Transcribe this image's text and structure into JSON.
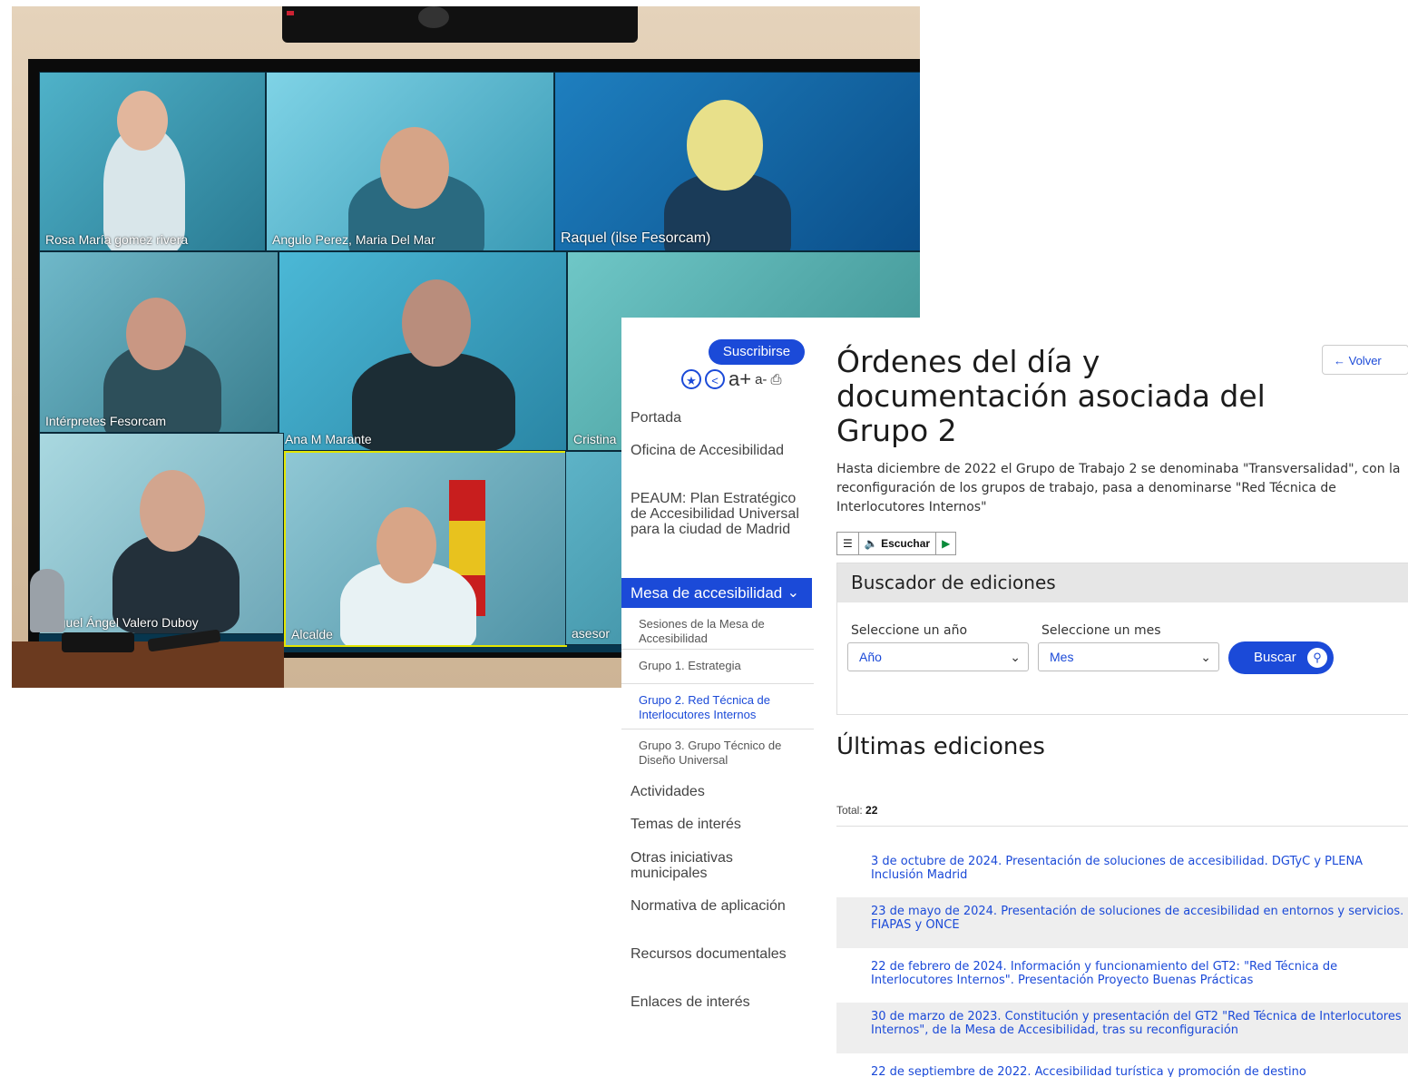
{
  "video_call": {
    "participants": [
      {
        "name": "Rosa María gomez rivera"
      },
      {
        "name": "Angulo Perez, Maria Del Mar"
      },
      {
        "name": "Raquel (ilse Fesorcam)"
      },
      {
        "name": "Intérpretes Fesorcam"
      },
      {
        "name": "Ana M Marante"
      },
      {
        "name": "Cristina"
      },
      {
        "name": "Miguel Ángel Valero Duboy"
      },
      {
        "name": "Alcalde"
      },
      {
        "name": "asesor"
      }
    ]
  },
  "web": {
    "subscribe_label": "Suscribirse",
    "tools": {
      "font_up": "a+",
      "font_down": "a-"
    },
    "nav": {
      "portada": "Portada",
      "oficina": "Oficina de Accesibilidad",
      "peaum": "PEAUM: Plan Estratégico de Accesibilidad Universal para la ciudad de Madrid",
      "mesa": "Mesa de accesibilidad",
      "sub": [
        "Sesiones de la Mesa de Accesibilidad",
        "Grupo 1. Estrategia",
        "Grupo 2. Red Técnica de Interlocutores Internos",
        "Grupo 3. Grupo Técnico de Diseño Universal"
      ],
      "actividades": "Actividades",
      "temas": "Temas de interés",
      "otras": "Otras iniciativas municipales",
      "normativa": "Normativa de aplicación",
      "recursos": "Recursos documentales",
      "enlaces": "Enlaces de interés"
    },
    "back_label": "Volver",
    "title": "Órdenes del día y documentación asociada del Grupo 2",
    "intro": "Hasta diciembre de 2022 el Grupo de Trabajo 2 se denominaba \"Transversalidad\", con la reconfiguración de los grupos de trabajo, pasa a denominarse \"Red Técnica de Interlocutores Internos\"",
    "player": {
      "listen_label": "Escuchar"
    },
    "search": {
      "heading": "Buscador de ediciones",
      "year_label": "Seleccione un año",
      "year_value": "Año",
      "month_label": "Seleccione un mes",
      "month_value": "Mes",
      "button_label": "Buscar"
    },
    "latest_title": "Últimas ediciones",
    "total_label": "Total:",
    "total_value": "22",
    "editions": [
      "3 de octubre de 2024. Presentación de soluciones de accesibilidad. DGTyC y PLENA Inclusión Madrid",
      "23 de mayo de 2024. Presentación de soluciones de accesibilidad en entornos y servicios. FIAPAS y ONCE",
      "22 de febrero de 2024. Información y funcionamiento del GT2: \"Red Técnica de Interlocutores Internos\". Presentación Proyecto Buenas Prácticas",
      "30 de marzo de 2023. Constitución y presentación del GT2 \"Red Técnica de Interlocutores Internos\", de la Mesa de Accesibilidad, tras su reconfiguración",
      "22 de septiembre de 2022. Accesibilidad turística y promoción de destino"
    ]
  }
}
